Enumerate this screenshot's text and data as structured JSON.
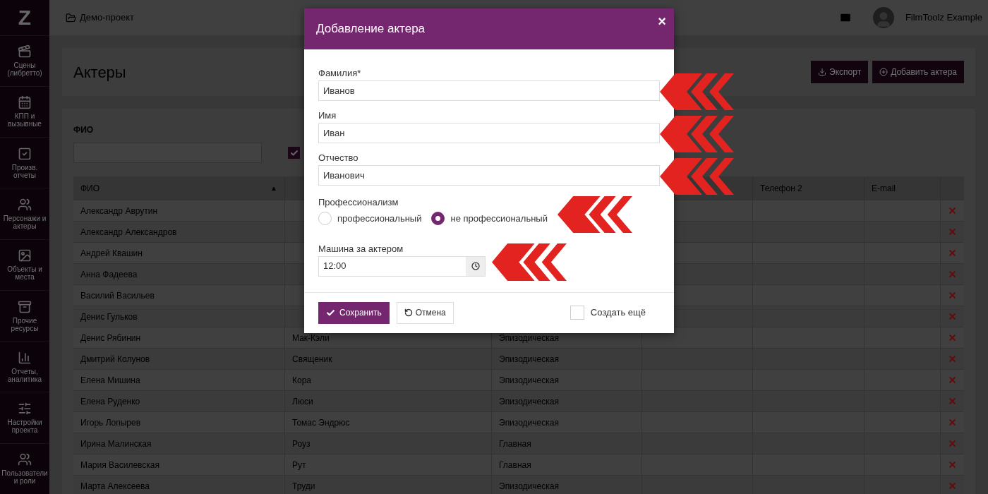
{
  "sidebar": {
    "logo": "Z",
    "items": [
      {
        "kind": "scenes",
        "label": "Сцены (либретто)"
      },
      {
        "kind": "calendar",
        "label": "КПП и вызывные"
      },
      {
        "kind": "reports",
        "label": "Произв. отчеты"
      },
      {
        "kind": "people",
        "label": "Персонажи и актеры"
      },
      {
        "kind": "image",
        "label": "Объекты и места"
      },
      {
        "kind": "box",
        "label": "Прочие ресурсы"
      },
      {
        "kind": "chart",
        "label": "Отчеты, аналитика"
      },
      {
        "kind": "sliders",
        "label": "Настройки проекта"
      },
      {
        "kind": "people",
        "label": "Пользователи и роли"
      }
    ]
  },
  "topbar": {
    "breadcrumb": "Демо-проект",
    "user": "FilmToolz Example"
  },
  "page": {
    "title": "Актеры",
    "export_button": "Экспорт",
    "add_button": "Добавить актера"
  },
  "filter": {
    "label": "ФИО",
    "checked": true
  },
  "table": {
    "header": {
      "column_1": "ФИО",
      "column_5": "Телефон 2",
      "column_6": "E-mail"
    },
    "sort_mark": "▲",
    "rows": [
      {
        "name": "Александр Аврутин"
      },
      {
        "name": "Александр Александров"
      },
      {
        "name": "Андрей Квашин"
      },
      {
        "name": "Анна Фадеева"
      },
      {
        "name": "Василий Васильев"
      },
      {
        "name": "Денис Гульков"
      },
      {
        "name": "Денис Рябинин",
        "column_2": "Мак-Кэли",
        "column_3": "Эпизодическая"
      },
      {
        "name": "Дмитрий Колунов",
        "column_2": "Священик",
        "column_3": "Эпизодическая"
      },
      {
        "name": "Елена Мишина",
        "column_2": "Кора",
        "column_3": "Эпизодическая"
      },
      {
        "name": "Елена Руденко",
        "column_2": "Люси",
        "column_3": "Эпизодическая"
      },
      {
        "name": "Игорь Лопырев",
        "column_2": "Томас Эндрюс",
        "column_3": "Эпизодическая"
      },
      {
        "name": "Ирина Малинская",
        "column_2": "Роуз",
        "column_3": "Главная"
      },
      {
        "name": "Мария Василевская",
        "column_2": "Рут",
        "column_3": "Главная"
      },
      {
        "name": "Марта Алексеева",
        "column_2": "Труди",
        "column_3": "Эпизодическая"
      }
    ]
  },
  "modal": {
    "title": "Добавление актера",
    "close": "×",
    "fields": [
      {
        "label": "Фамилия",
        "required_mark": "*",
        "value": "Иванов"
      },
      {
        "label": "Имя",
        "value": "Иван"
      },
      {
        "label": "Отчество",
        "value": "Иванович"
      }
    ],
    "radio_group": {
      "label": "Профессионализм",
      "options": [
        {
          "label": "профессиональный",
          "selected": false
        },
        {
          "label": "не профессиональный",
          "selected": true
        }
      ]
    },
    "time_field": {
      "label": "Машина за актером",
      "value": "12:00"
    },
    "save_button": "Сохранить",
    "cancel_button": "Отмена",
    "create_more": {
      "label": "Создать ещё",
      "checked": false
    }
  }
}
